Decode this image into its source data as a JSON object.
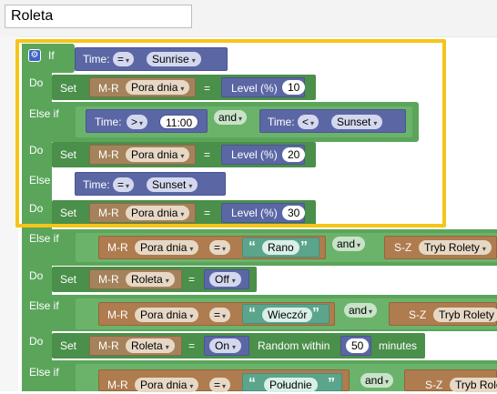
{
  "program_name": "Roleta",
  "colors": {
    "selection": "#f5c518",
    "logic": "#5ba55b",
    "time": "#5b67a5",
    "var": "#a5825b",
    "text": "#5ba58c"
  },
  "blocks": {
    "if": "If",
    "do": "Do",
    "else_if": "Else if",
    "set": "Set",
    "and": "and",
    "time": "Time:",
    "eq": "=",
    "gt": ">",
    "lt": "<",
    "sunrise": "Sunrise",
    "sunset": "Sunset",
    "t1100": "11:00",
    "mr": "M-R",
    "sz": "S-Z",
    "pora_dnia": "Pora dnia",
    "roleta": "Roleta",
    "tryb_rolety": "Tryb Rolety",
    "tryb_trunc": "Tryb Rolet",
    "level": "Level (%)",
    "l10": "10",
    "l20": "20",
    "l30": "30",
    "rano": "Rano",
    "wieczor": "Wieczór",
    "poludnie": "Południe",
    "off": "Off",
    "on": "On",
    "random_within": "Random within",
    "r50": "50",
    "minutes": "minutes",
    "qopen": "“",
    "qclose": "”"
  }
}
